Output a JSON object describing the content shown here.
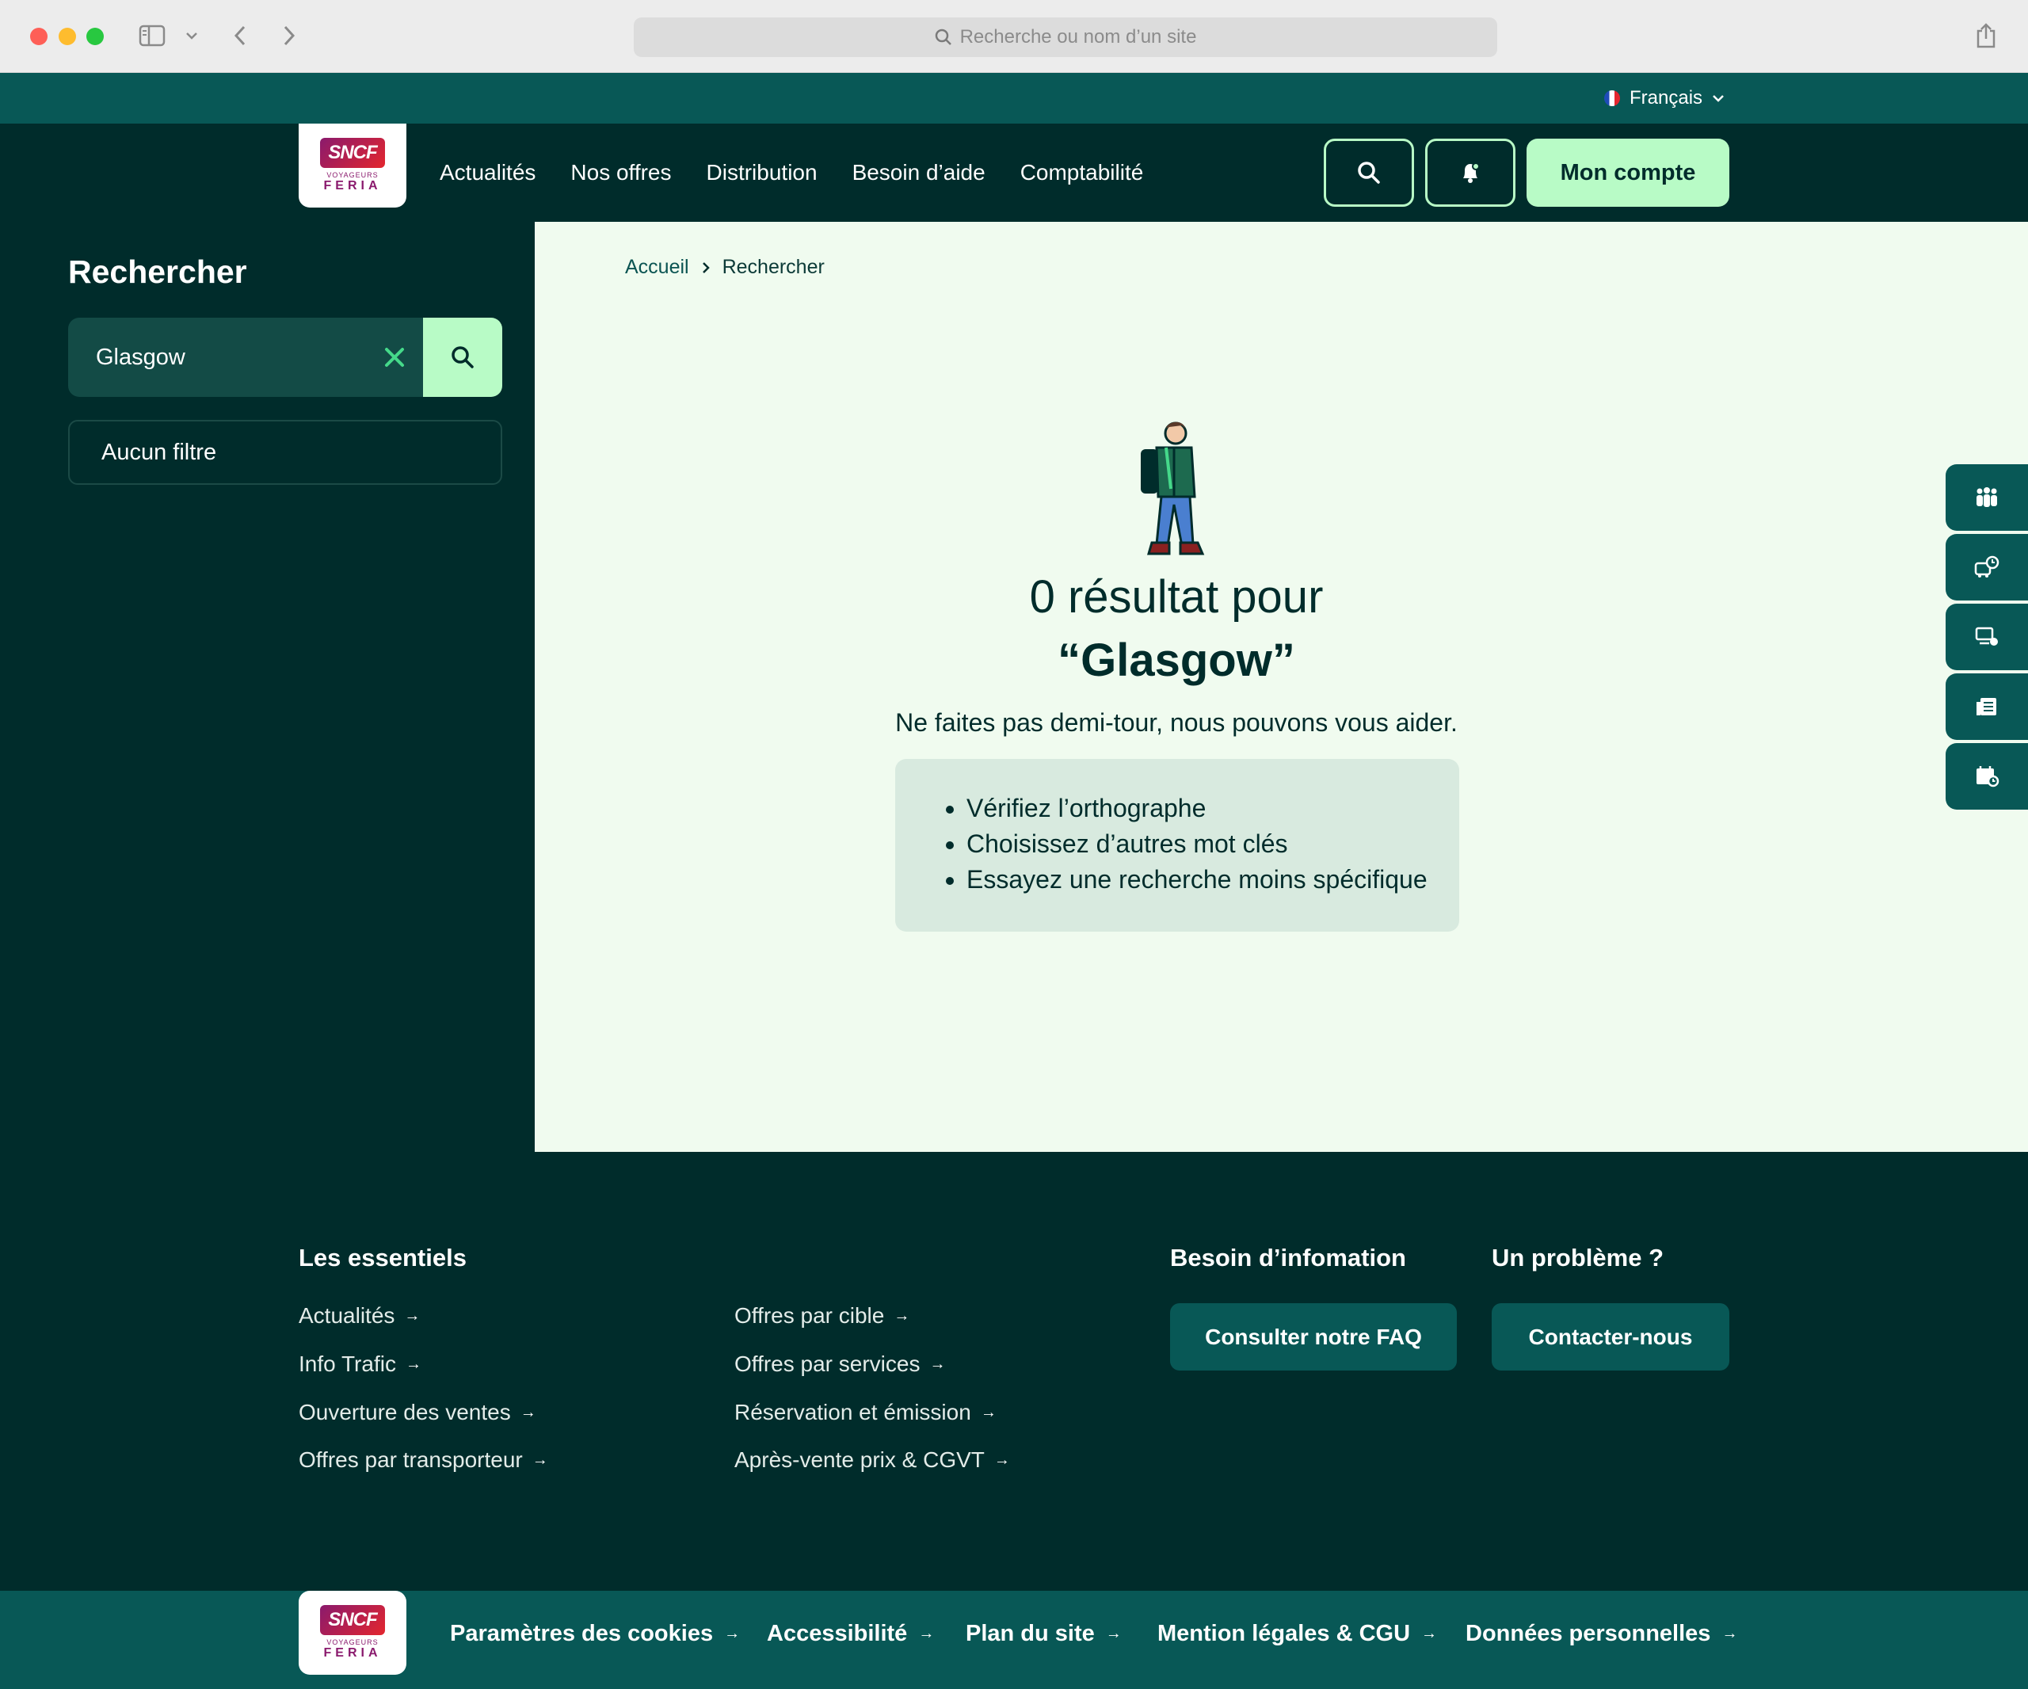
{
  "browser": {
    "url_placeholder": "Recherche ou nom d’un site"
  },
  "language": "Français",
  "header": {
    "brand": {
      "mark": "SNCF",
      "line1": "VOYAGEURS",
      "line2": "FERIA"
    },
    "nav": [
      "Actualités",
      "Nos offres",
      "Distribution",
      "Besoin d’aide",
      "Comptabilité"
    ],
    "account_label": "Mon compte",
    "accent_color": "#b8fbc6"
  },
  "sidebar": {
    "title": "Rechercher",
    "search_value": "Glasgow",
    "filter_label": "Aucun filtre"
  },
  "breadcrumb": {
    "home": "Accueil",
    "current": "Rechercher"
  },
  "results": {
    "title": "0 résultat pour",
    "query": "“Glasgow”",
    "subtitle": "Ne faites pas demi-tour, nous pouvons vous aider.",
    "tips": [
      "Vérifiez l’orthographe",
      "Choisissez d’autres mot clés",
      "Essayez une recherche moins spécifique"
    ]
  },
  "tools": [
    "people-icon",
    "bus-clock-icon",
    "computer-icon",
    "document-icon",
    "calendar-clock-icon"
  ],
  "footer": {
    "essentials_title": "Les essentiels",
    "essentials_col1": [
      "Actualités",
      "Info Trafic",
      "Ouverture des ventes",
      "Offres par transporteur"
    ],
    "essentials_col2": [
      "Offres par cible",
      "Offres par services",
      "Réservation et émission",
      "Après-vente prix & CGVT"
    ],
    "info_title": "Besoin d’infomation",
    "faq_button": "Consulter notre FAQ",
    "problem_title": "Un problème ?",
    "contact_button": "Contacter-nous",
    "bottom_links": [
      "Paramètres des cookies",
      "Accessibilité",
      "Plan du site",
      "Mention légales & CGU",
      "Données personnelles"
    ]
  }
}
